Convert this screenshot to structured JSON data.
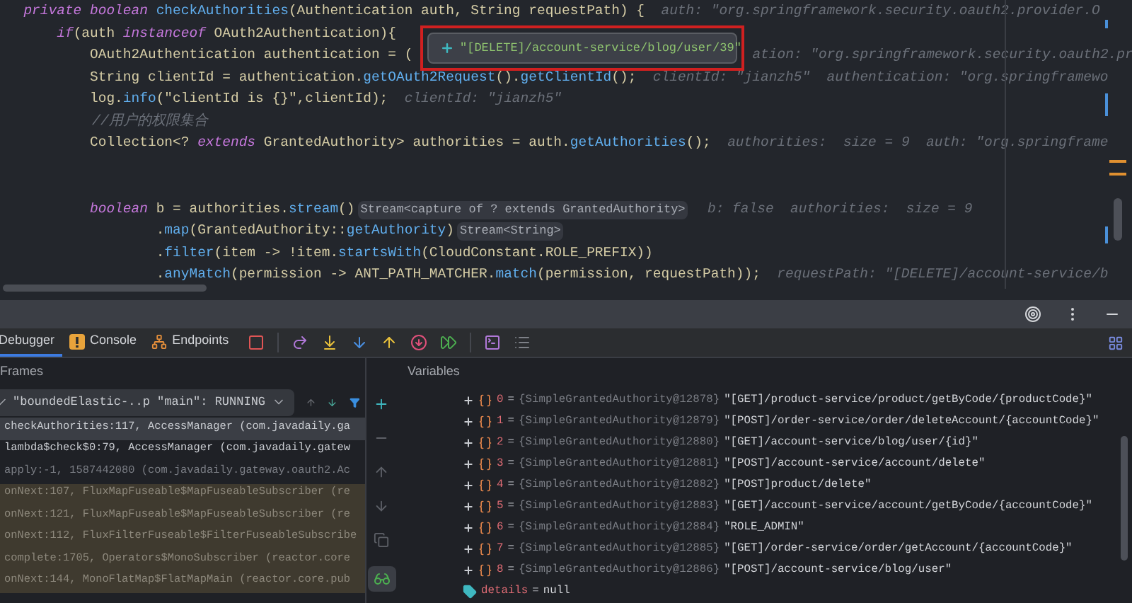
{
  "editor": {
    "lines": [
      {
        "kind": "code",
        "segments": [
          {
            "text": "  private boolean",
            "kind": "kw"
          },
          {
            "text": " checkAuthorities",
            "kind": "fn"
          },
          {
            "text": "(Authentication auth, String requestPath) {",
            "kind": "plain"
          },
          {
            "text": "  auth: \"org.springframework.security.oauth2.provider.O",
            "kind": "hint"
          }
        ]
      },
      {
        "kind": "code",
        "segments": [
          {
            "text": "      if",
            "kind": "kw"
          },
          {
            "text": "(auth ",
            "kind": "plain"
          },
          {
            "text": "instanceof",
            "kind": "kw"
          },
          {
            "text": " OAuth2Authentication){",
            "kind": "plain"
          }
        ]
      },
      {
        "kind": "code",
        "segments": [
          {
            "text": "          OAuth2Authentication authentication = (",
            "kind": "plain"
          }
        ],
        "tail": "ation: \"org.springframework.security.oauth2.pr"
      },
      {
        "kind": "code",
        "segments": [
          {
            "text": "          String clientId = authentication.",
            "kind": "plain"
          },
          {
            "text": "getOAuth2Request",
            "kind": "fn"
          },
          {
            "text": "().",
            "kind": "plain"
          },
          {
            "text": "getClientId",
            "kind": "fn"
          },
          {
            "text": "();",
            "kind": "plain"
          },
          {
            "text": "  clientId: \"jianzh5\"  authentication: \"org.springframewo",
            "kind": "hint"
          }
        ]
      },
      {
        "kind": "code",
        "segments": [
          {
            "text": "          log.",
            "kind": "plain"
          },
          {
            "text": "info",
            "kind": "fn"
          },
          {
            "text": "(\"clientId is {}\",clientId);",
            "kind": "plain"
          },
          {
            "text": "  clientId: \"jianzh5\"",
            "kind": "hint"
          }
        ]
      },
      {
        "kind": "code",
        "segments": [
          {
            "text": "          //用户的权限集合",
            "kind": "comment"
          }
        ]
      },
      {
        "kind": "code",
        "segments": [
          {
            "text": "          Collection<? ",
            "kind": "plain"
          },
          {
            "text": "extends",
            "kind": "kw"
          },
          {
            "text": " GrantedAuthority> authorities = auth.",
            "kind": "plain"
          },
          {
            "text": "getAuthorities",
            "kind": "fn"
          },
          {
            "text": "();",
            "kind": "plain"
          },
          {
            "text": "  authorities:  size = 9  auth: \"org.springframe",
            "kind": "hint"
          }
        ]
      },
      {
        "kind": "blank"
      },
      {
        "kind": "blank"
      },
      {
        "kind": "code",
        "segments": [
          {
            "text": "          boolean",
            "kind": "kw"
          },
          {
            "text": " b = authorities.",
            "kind": "plain"
          },
          {
            "text": "stream",
            "kind": "fn"
          },
          {
            "text": "()",
            "kind": "plain"
          },
          {
            "text": "Stream<capture of ? extends GrantedAuthority>",
            "kind": "inlay"
          },
          {
            "text": "  b: false  authorities:  size = 9",
            "kind": "hint"
          }
        ]
      },
      {
        "kind": "code",
        "segments": [
          {
            "text": "                  .",
            "kind": "plain"
          },
          {
            "text": "map",
            "kind": "fn"
          },
          {
            "text": "(GrantedAuthority::",
            "kind": "plain"
          },
          {
            "text": "getAuthority",
            "kind": "fn"
          },
          {
            "text": ")",
            "kind": "plain"
          },
          {
            "text": "Stream<String>",
            "kind": "inlay"
          }
        ]
      },
      {
        "kind": "code",
        "segments": [
          {
            "text": "                  .",
            "kind": "plain"
          },
          {
            "text": "filter",
            "kind": "fn"
          },
          {
            "text": "(item -> !item.",
            "kind": "plain"
          },
          {
            "text": "startsWith",
            "kind": "fn"
          },
          {
            "text": "(CloudConstant.ROLE_PREFIX))",
            "kind": "plain"
          }
        ]
      },
      {
        "kind": "code",
        "segments": [
          {
            "text": "                  .",
            "kind": "plain"
          },
          {
            "text": "anyMatch",
            "kind": "fn"
          },
          {
            "text": "(permission -> ANT_PATH_MATCHER.",
            "kind": "plain"
          },
          {
            "text": "match",
            "kind": "fn"
          },
          {
            "text": "(permission, requestPath));",
            "kind": "plain"
          },
          {
            "text": "  requestPath: \"[DELETE]/account-service/b",
            "kind": "hint"
          }
        ]
      }
    ],
    "value_popup": {
      "text": "\"[DELETE]/account-service/blog/user/39\""
    }
  },
  "debug_tabs": [
    {
      "label": "Debugger",
      "selected": true,
      "kind": "plain"
    },
    {
      "label": "Console",
      "selected": false,
      "kind": "console"
    },
    {
      "label": "Endpoints",
      "selected": false,
      "kind": "endpoints"
    }
  ],
  "frames": {
    "title": "Frames",
    "thread": "\"boundedElastic-..p \"main\": RUNNING",
    "rows": [
      {
        "text": "checkAuthorities:117, AccessManager (com.javadaily.ga",
        "kind": "app",
        "selected": true
      },
      {
        "text": "lambda$check$0:79, AccessManager (com.javadaily.gatew",
        "kind": "app",
        "selected": false
      },
      {
        "text": "apply:-1, 1587442080 (com.javadaily.gateway.oauth2.Ac",
        "kind": "hidden",
        "selected": false
      },
      {
        "text": "onNext:107, FluxMapFuseable$MapFuseableSubscriber (re",
        "kind": "library",
        "selected": false
      },
      {
        "text": "onNext:121, FluxMapFuseable$MapFuseableSubscriber (re",
        "kind": "library",
        "selected": false
      },
      {
        "text": "onNext:112, FluxFilterFuseable$FilterFuseableSubscribe",
        "kind": "library",
        "selected": false
      },
      {
        "text": "complete:1705, Operators$MonoSubscriber (reactor.core",
        "kind": "library",
        "selected": false
      },
      {
        "text": "onNext:144, MonoFlatMap$FlatMapMain (reactor.core.pub",
        "kind": "library",
        "selected": false
      }
    ]
  },
  "variables": {
    "title": "Variables",
    "rows": [
      {
        "kind": "element",
        "expanded": false,
        "name": "0",
        "operator": "=",
        "type": "{SimpleGrantedAuthority@12878}",
        "value": "\"[GET]/product-service/product/getByCode/{productCode}\""
      },
      {
        "kind": "element",
        "expanded": false,
        "name": "1",
        "operator": "=",
        "type": "{SimpleGrantedAuthority@12879}",
        "value": "\"[POST]/order-service/order/deleteAccount/{accountCode}\""
      },
      {
        "kind": "element",
        "expanded": false,
        "name": "2",
        "operator": "=",
        "type": "{SimpleGrantedAuthority@12880}",
        "value": "\"[GET]/account-service/blog/user/{id}\""
      },
      {
        "kind": "element",
        "expanded": false,
        "name": "3",
        "operator": "=",
        "type": "{SimpleGrantedAuthority@12881}",
        "value": "\"[POST]/account-service/account/delete\""
      },
      {
        "kind": "element",
        "expanded": false,
        "name": "4",
        "operator": "=",
        "type": "{SimpleGrantedAuthority@12882}",
        "value": "\"[POST]product/delete\""
      },
      {
        "kind": "element",
        "expanded": false,
        "name": "5",
        "operator": "=",
        "type": "{SimpleGrantedAuthority@12883}",
        "value": "\"[GET]/account-service/account/getByCode/{accountCode}\""
      },
      {
        "kind": "element",
        "expanded": false,
        "name": "6",
        "operator": "=",
        "type": "{SimpleGrantedAuthority@12884}",
        "value": "\"ROLE_ADMIN\""
      },
      {
        "kind": "element",
        "expanded": false,
        "name": "7",
        "operator": "=",
        "type": "{SimpleGrantedAuthority@12885}",
        "value": "\"[GET]/order-service/order/getAccount/{accountCode}\""
      },
      {
        "kind": "element",
        "expanded": false,
        "name": "8",
        "operator": "=",
        "type": "{SimpleGrantedAuthority@12886}",
        "value": "\"[POST]/account-service/blog/user\""
      },
      {
        "kind": "field",
        "name": "details",
        "operator": "=",
        "value": "null"
      }
    ]
  }
}
